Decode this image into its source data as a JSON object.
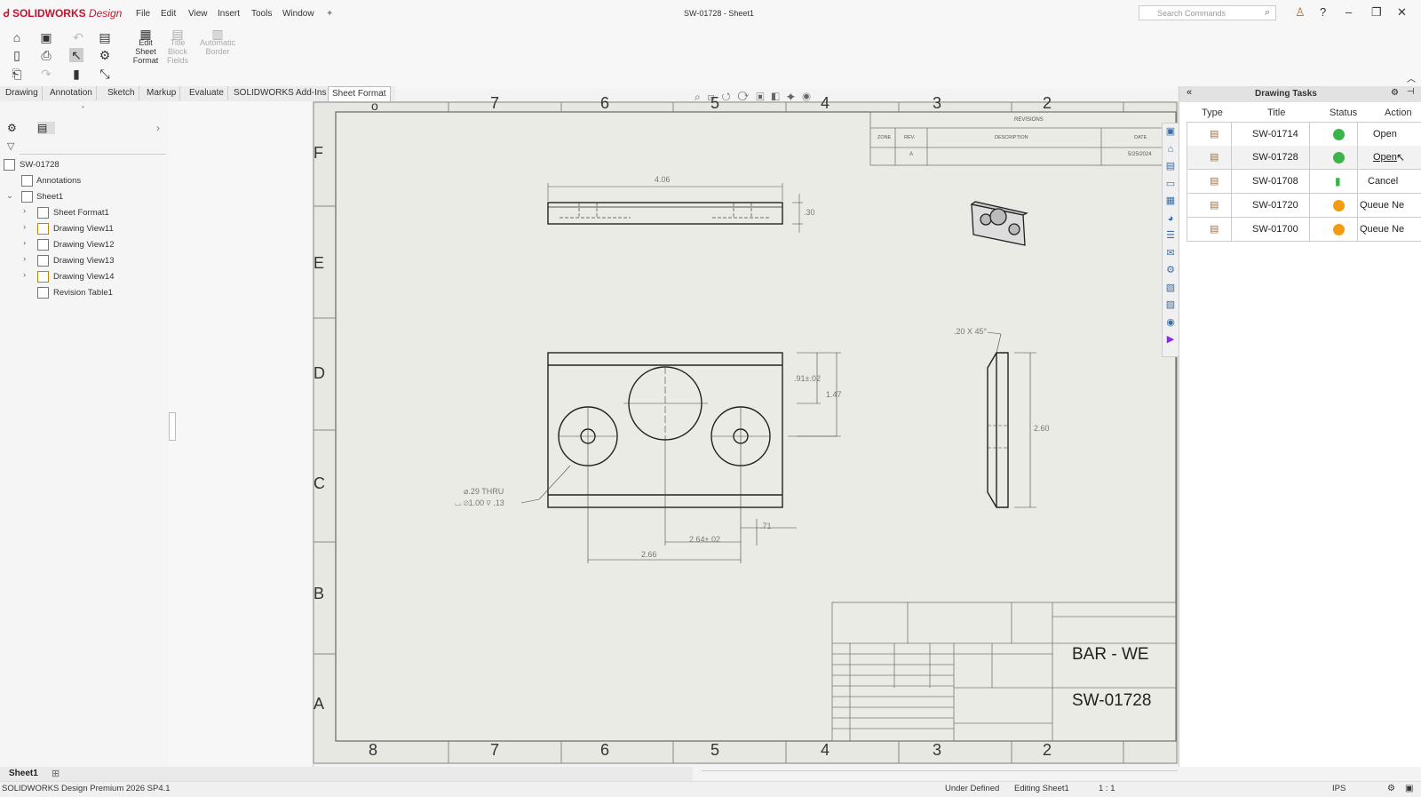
{
  "app": {
    "brand": "SOLIDWORKS",
    "brand_sub": "Design",
    "window_title": "SW-01728 - Sheet1",
    "search_placeholder": "Search Commands",
    "accent": "#c8102e"
  },
  "menu": [
    "File",
    "Edit",
    "View",
    "Insert",
    "Tools",
    "Window"
  ],
  "command_manager": {
    "edit_sheet_format": [
      "Edit",
      "Sheet",
      "Format"
    ],
    "title_block_fields": [
      "Title",
      "Block",
      "Fields"
    ],
    "automatic_border": [
      "Automatic",
      "Border"
    ]
  },
  "tabs": [
    {
      "label": "Drawing"
    },
    {
      "label": "Annotation"
    },
    {
      "label": "Sketch"
    },
    {
      "label": "Markup"
    },
    {
      "label": "Evaluate"
    },
    {
      "label": "SOLIDWORKS Add-Ins"
    },
    {
      "label": "Sheet Format",
      "active": true
    }
  ],
  "feature_tree": {
    "root": "SW-01728",
    "items": [
      {
        "label": "Annotations"
      },
      {
        "label": "Sheet1"
      },
      {
        "label": "Sheet Format1"
      },
      {
        "label": "Drawing View11"
      },
      {
        "label": "Drawing View12"
      },
      {
        "label": "Drawing View13"
      },
      {
        "label": "Drawing View14"
      },
      {
        "label": "Revision Table1"
      }
    ]
  },
  "drawing": {
    "zones_top": [
      "8",
      "7",
      "6",
      "5",
      "4",
      "3",
      "2"
    ],
    "zones_side": [
      "F",
      "E",
      "D",
      "C",
      "B",
      "A"
    ],
    "revisions_header": "REVISIONS",
    "rev_cols": [
      "ZONE",
      "REV.",
      "DESCRIPTION",
      "DATE"
    ],
    "rev_row": [
      "A",
      "5/25/2024"
    ],
    "dims": {
      "top_width": "4.06",
      "top_thick": ".30",
      "hole_note_1": "⌀.29 THRU",
      "hole_note_2": "⌴ ⌀1.00 ⊽ .13",
      "height_1": ".91±.02",
      "height_2": "1.47",
      "x_1": ".71",
      "x_2": "2.64±.02",
      "x_3": "2.66",
      "chamfer": ".20 X 45°",
      "side_height": "2.60"
    },
    "title_block_name": "BAR - WE",
    "title_block_number": "SW-01728"
  },
  "task_pane": {
    "title": "Drawing Tasks",
    "columns": [
      "Type",
      "Title",
      "Status",
      "Action"
    ],
    "rows": [
      {
        "title": "SW-01714",
        "status": "done",
        "action": "Open"
      },
      {
        "title": "SW-01728",
        "status": "done",
        "action": "Open"
      },
      {
        "title": "SW-01708",
        "status": "running",
        "action": "Cancel"
      },
      {
        "title": "SW-01720",
        "status": "queued",
        "action": "Queue Ne"
      },
      {
        "title": "SW-01700",
        "status": "queued",
        "action": "Queue Ne"
      }
    ],
    "status_colors": {
      "done": "#3bb54a",
      "running": "#3bb54a",
      "queued": "#f39c12"
    }
  },
  "sheet_tab": "Sheet1",
  "statusbar": {
    "version": "SOLIDWORKS Design Premium 2026 SP4.1",
    "state": "Under Defined",
    "editing": "Editing Sheet1",
    "scale": "1 : 1",
    "units": "IPS"
  }
}
